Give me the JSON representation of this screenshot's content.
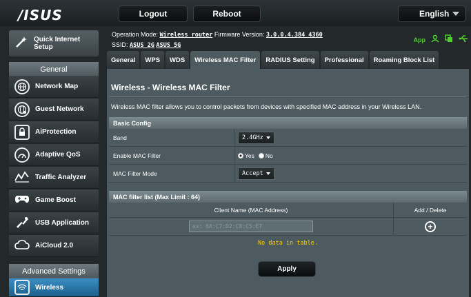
{
  "brand": {
    "logo_text": "/ISUS",
    "accent_color": "#4fd12c",
    "highlight_color": "#2a78ad",
    "nodata_color": "#ffcc00"
  },
  "topbar": {
    "logout_label": "Logout",
    "reboot_label": "Reboot",
    "language_label": "English"
  },
  "status": {
    "op_mode_label": "Operation Mode:",
    "op_mode_value": "Wireless router",
    "fw_label": "Firmware Version:",
    "fw_value": "3.0.0.4.384_4360",
    "ssid_label": "SSID:",
    "ssid_2g": "ASUS_2G",
    "ssid_5g": "ASUS_5G",
    "app_label": "App",
    "icons": [
      "user-icon",
      "copy-icon",
      "usb-icon"
    ]
  },
  "sidebar": {
    "quick_setup_label": "Quick Internet Setup",
    "general_header": "General",
    "items": [
      {
        "label": "Network Map",
        "icon": "globe-icon"
      },
      {
        "label": "Guest Network",
        "icon": "guest-globe-icon"
      },
      {
        "label": "AiProtection",
        "icon": "lock-icon"
      },
      {
        "label": "Adaptive QoS",
        "icon": "gauge-icon"
      },
      {
        "label": "Traffic Analyzer",
        "icon": "chart-icon"
      },
      {
        "label": "Game Boost",
        "icon": "gamepad-icon"
      },
      {
        "label": "USB Application",
        "icon": "puzzle-icon"
      },
      {
        "label": "AiCloud 2.0",
        "icon": "cloud-icon"
      }
    ],
    "advanced_header": "Advanced Settings",
    "wireless_label": "Wireless"
  },
  "tabs": [
    {
      "label": "General"
    },
    {
      "label": "WPS"
    },
    {
      "label": "WDS"
    },
    {
      "label": "Wireless MAC Filter"
    },
    {
      "label": "RADIUS Setting"
    },
    {
      "label": "Professional"
    },
    {
      "label": "Roaming Block List"
    }
  ],
  "main": {
    "title": "Wireless - Wireless MAC Filter",
    "description": "Wireless MAC filter allows you to control packets from devices with specified MAC address in your Wireless LAN.",
    "basic_config_header": "Basic Config",
    "band_label": "Band",
    "band_value": "2.4GHz",
    "enable_label": "Enable MAC Filter",
    "enable_yes": "Yes",
    "enable_no": "No",
    "enable_selected": "Yes",
    "mode_label": "MAC Filter Mode",
    "mode_value": "Accept",
    "list_header": "MAC filter list (Max Limit : 64)",
    "col_client": "Client Name (MAC Address)",
    "col_action": "Add / Delete",
    "mac_placeholder": "ex: 6A:C7:D2:C8:C5:E7",
    "no_data": "No data in table.",
    "apply_label": "Apply"
  }
}
